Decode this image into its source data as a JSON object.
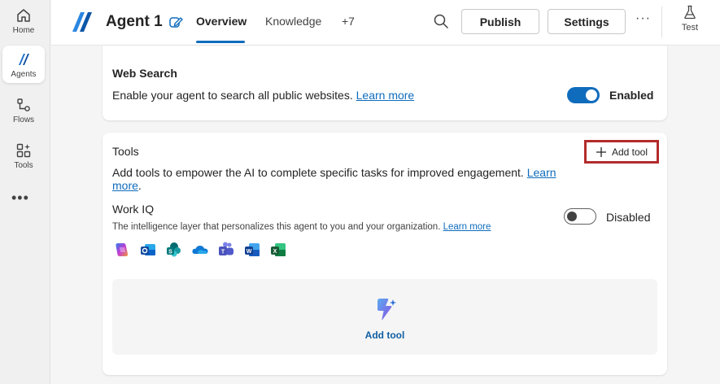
{
  "rail": {
    "items": [
      {
        "label": "Home",
        "icon": "home-icon"
      },
      {
        "label": "Agents",
        "icon": "agents-icon"
      },
      {
        "label": "Flows",
        "icon": "flows-icon"
      },
      {
        "label": "Tools",
        "icon": "tools-icon"
      }
    ],
    "more": "•••"
  },
  "header": {
    "title": "Agent 1",
    "tabs": [
      "Overview",
      "Knowledge",
      "+7"
    ],
    "publish_label": "Publish",
    "settings_label": "Settings",
    "more_label": "···",
    "test_label": "Test"
  },
  "web_search": {
    "title": "Web Search",
    "description": "Enable your agent to search all public websites.",
    "link": "Learn more",
    "state_label": "Enabled",
    "enabled": true
  },
  "tools": {
    "title": "Tools",
    "add_label": "Add tool",
    "description_line1": "Add tools to empower the AI to complete specific tasks for improved engagement.",
    "link_part1": "Learn",
    "link_part2": "more",
    "period": ".",
    "work_iq": {
      "title": "Work IQ",
      "description": "The intelligence layer that personalizes this agent to you and your organization.",
      "link": "Learn more",
      "state_label": "Disabled",
      "enabled": false,
      "apps": [
        "copilot-icon",
        "outlook-icon",
        "sharepoint-icon",
        "onedrive-icon",
        "teams-icon",
        "word-icon",
        "excel-icon"
      ]
    },
    "empty_add_label": "Add tool"
  },
  "colors": {
    "accent": "#0f6cbd",
    "highlight": "#b32b2b"
  }
}
